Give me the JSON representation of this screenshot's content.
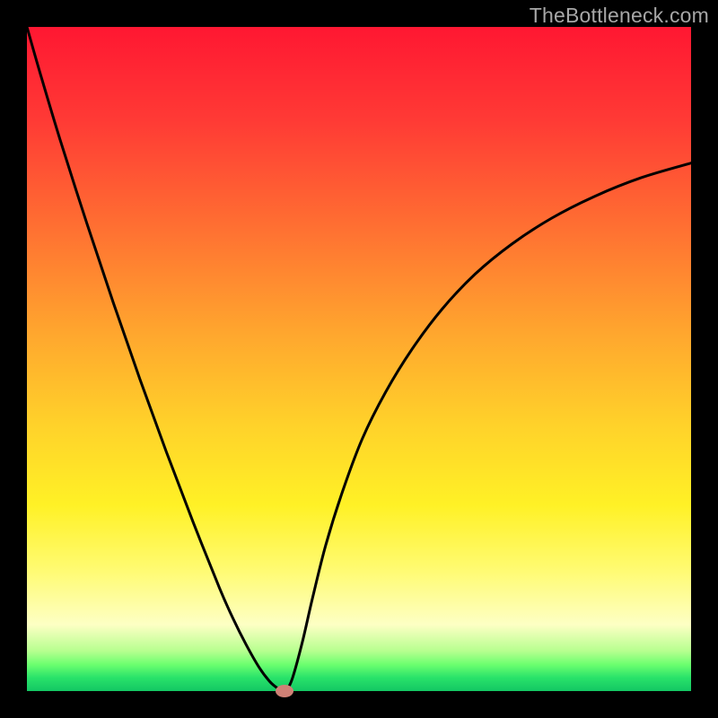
{
  "watermark": "TheBottleneck.com",
  "chart_data": {
    "type": "line",
    "title": "",
    "xlabel": "",
    "ylabel": "",
    "xlim": [
      0,
      1
    ],
    "ylim": [
      0,
      1
    ],
    "series": [
      {
        "name": "bottleneck-curve",
        "x": [
          0.0,
          0.02,
          0.05,
          0.09,
          0.13,
          0.17,
          0.21,
          0.25,
          0.29,
          0.31,
          0.33,
          0.35,
          0.365,
          0.375,
          0.382,
          0.388,
          0.392,
          0.4,
          0.415,
          0.43,
          0.45,
          0.475,
          0.505,
          0.54,
          0.58,
          0.625,
          0.675,
          0.73,
          0.79,
          0.855,
          0.925,
          1.0
        ],
        "values": [
          1.0,
          0.93,
          0.83,
          0.705,
          0.585,
          0.47,
          0.36,
          0.255,
          0.155,
          0.11,
          0.07,
          0.035,
          0.015,
          0.006,
          0.002,
          0.0,
          0.003,
          0.02,
          0.075,
          0.14,
          0.22,
          0.3,
          0.38,
          0.45,
          0.515,
          0.575,
          0.628,
          0.673,
          0.712,
          0.745,
          0.773,
          0.795
        ]
      }
    ],
    "marker": {
      "x": 0.388,
      "y": 0.0
    },
    "gradient_stops": [
      {
        "pos": 0.0,
        "color": "#ff1732"
      },
      {
        "pos": 0.14,
        "color": "#ff3a35"
      },
      {
        "pos": 0.3,
        "color": "#ff6f32"
      },
      {
        "pos": 0.46,
        "color": "#ffa62e"
      },
      {
        "pos": 0.6,
        "color": "#ffd22a"
      },
      {
        "pos": 0.72,
        "color": "#fff126"
      },
      {
        "pos": 0.82,
        "color": "#fffb74"
      },
      {
        "pos": 0.9,
        "color": "#fdffc4"
      },
      {
        "pos": 0.94,
        "color": "#b6ff8f"
      },
      {
        "pos": 0.96,
        "color": "#6cff6f"
      },
      {
        "pos": 0.98,
        "color": "#29e26a"
      },
      {
        "pos": 1.0,
        "color": "#13c763"
      }
    ]
  }
}
